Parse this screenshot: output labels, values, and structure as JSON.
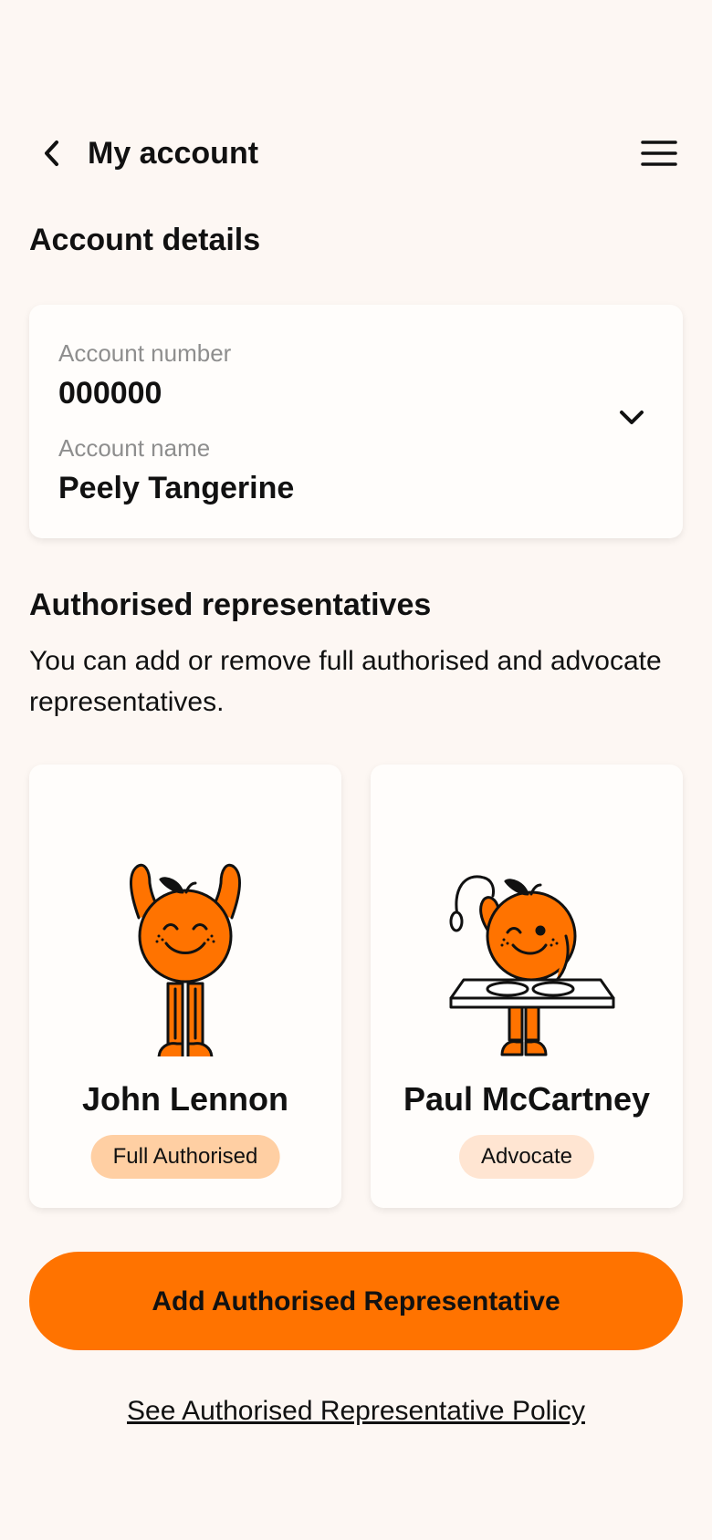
{
  "header": {
    "title": "My account",
    "back_icon": "chevron-left-icon",
    "menu_icon": "hamburger-menu-icon"
  },
  "account_details": {
    "heading": "Account details",
    "account_number_label": "Account number",
    "account_number": "000000",
    "account_name_label": "Account name",
    "account_name": "Peely Tangerine",
    "expand_icon": "chevron-down-icon"
  },
  "representatives": {
    "heading": "Authorised representatives",
    "description": "You can add or remove full authorised and advocate representatives.",
    "items": [
      {
        "name": "John Lennon",
        "role": "Full Authorised",
        "badge_color": "#ffcfa3",
        "mascot": "tangerine-arms-up-icon"
      },
      {
        "name": "Paul McCartney",
        "role": "Advocate",
        "badge_color": "#ffe5d2",
        "mascot": "tangerine-dj-icon"
      }
    ]
  },
  "actions": {
    "add_label": "Add Authorised Representative",
    "policy_link": "See Authorised Representative Policy"
  },
  "colors": {
    "accent": "#ff7300",
    "background": "#fdf7f3"
  }
}
